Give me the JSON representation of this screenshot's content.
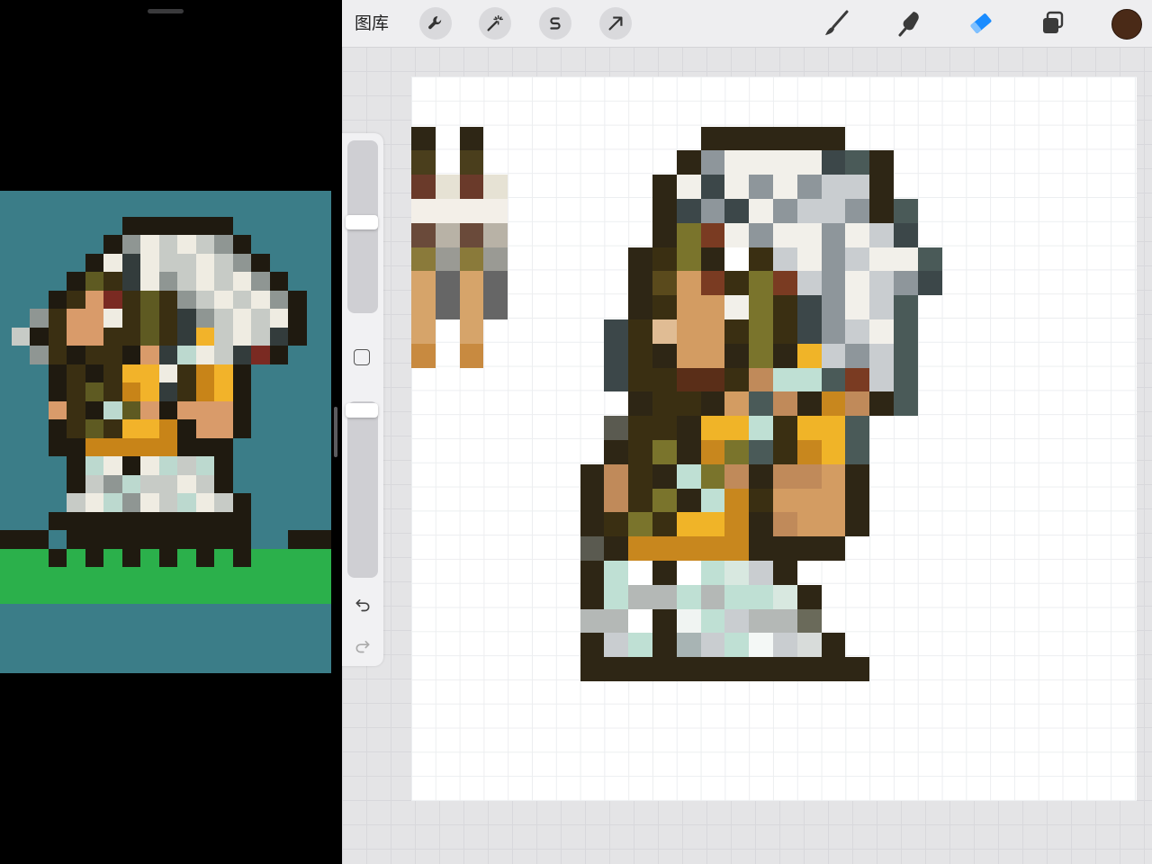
{
  "toolbar": {
    "gallery_label": "图库",
    "left_tools": [
      {
        "icon": "wrench-icon"
      },
      {
        "icon": "magic-wand-icon"
      },
      {
        "icon": "selection-s-icon"
      },
      {
        "icon": "transform-arrow-icon"
      }
    ],
    "right_tools": [
      {
        "icon": "brush-icon"
      },
      {
        "icon": "smudge-icon"
      },
      {
        "icon": "eraser-icon",
        "active": true,
        "accent": "#1a8cff"
      },
      {
        "icon": "layers-icon"
      }
    ],
    "current_color": "#4a2a17"
  },
  "sidebar": {
    "size_slider_level": 0.35,
    "opacity_slider_level": 0.03,
    "icons": [
      "modify-square-icon",
      "undo-icon",
      "redo-icon"
    ]
  },
  "colors": {
    "ref_bg": "#3b7d88",
    "ground": "#2bb04b",
    "canvas_bg": "#ffffff"
  }
}
